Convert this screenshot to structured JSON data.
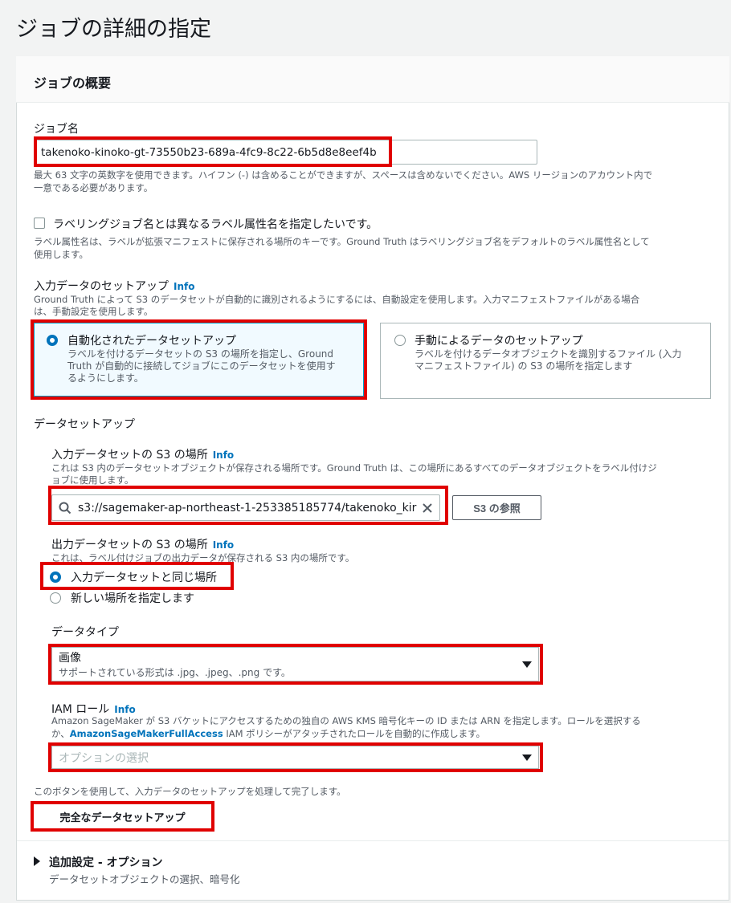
{
  "page": {
    "title": "ジョブの詳細の指定"
  },
  "overview": {
    "title": "ジョブの概要",
    "job_name": {
      "label": "ジョブ名",
      "value": "takenoko-kinoko-gt-73550b23-689a-4fc9-8c22-6b5d8e8eef4b",
      "hint_1": "最大 63 文字の英数字を使用できます。ハイフン (-) は含めることができますが、スペースは含めないでください。AWS リージョンのアカウント内で",
      "hint_2": "一意である必要があります。"
    },
    "label_attr": {
      "checkbox_label": "ラベリングジョブ名とは異なるラベル属性名を指定したいです。",
      "hint_1": "ラベル属性名は、ラベルが拡張マニフェストに保存される場所のキーです。Ground Truth はラベリングジョブ名をデフォルトのラベル属性名として",
      "hint_2": "使用します。"
    },
    "input_setup": {
      "label": "入力データのセットアップ",
      "info": "Info",
      "hint_1": "Ground Truth によって S3 のデータセットが自動的に識別されるようにするには、自動設定を使用します。入力マニフェストファイルがある場合",
      "hint_2": "は、手動設定を使用します。",
      "auto": {
        "title": "自動化されたデータセットアップ",
        "desc_1": "ラベルを付けるデータセットの S3 の場所を指定し、Ground",
        "desc_2": "Truth が自動的に接続してジョブにこのデータセットを使用す",
        "desc_3": "るようにします。"
      },
      "manual": {
        "title": "手動によるデータのセットアップ",
        "desc_1": "ラベルを付けるデータオブジェクトを識別するファイル (入力",
        "desc_2": "マニフェストファイル) の S3 の場所を指定します"
      }
    },
    "data_setup": {
      "label": "データセットアップ",
      "input_location": {
        "label": "入力データセットの S3 の場所",
        "info": "Info",
        "hint_1": "これは S3 内のデータセットオブジェクトが保存される場所です。Ground Truth は、この場所にあるすべてのデータオブジェクトをラベル付けジ",
        "hint_2": "ョブに使用します。",
        "value": "s3://sagemaker-ap-northeast-1-253385185774/takenoko_kir",
        "browse_button": "S3 の参照"
      },
      "output_location": {
        "label": "出力データセットの S3 の場所",
        "info": "Info",
        "hint": "これは、ラベル付けジョブの出力データが保存される S3 内の場所です。",
        "option_same": "入力データセットと同じ場所",
        "option_new": "新しい場所を指定します"
      },
      "data_type": {
        "label": "データタイプ",
        "value": "画像",
        "sub": "サポートされている形式は .jpg、.jpeg、.png です。"
      },
      "iam_role": {
        "label": "IAM ロール",
        "info": "Info",
        "hint_1": "Amazon SageMaker が S3 バケットにアクセスするための独自の AWS KMS 暗号化キーの ID または ARN を指定します。ロールを選択する",
        "hint_2_pre": "か、",
        "hint_2_link": "AmazonSageMakerFullAccess",
        "hint_2_post": " IAM ポリシーがアタッチされたロールを自動的に作成します。",
        "placeholder": "オプションの選択"
      }
    },
    "complete": {
      "hint": "このボタンを使用して、入力データのセットアップを処理して完了します。",
      "button": "完全なデータセットアップ"
    },
    "additional": {
      "title": "追加設定 - オプション",
      "desc": "データセットオブジェクトの選択、暗号化"
    }
  }
}
